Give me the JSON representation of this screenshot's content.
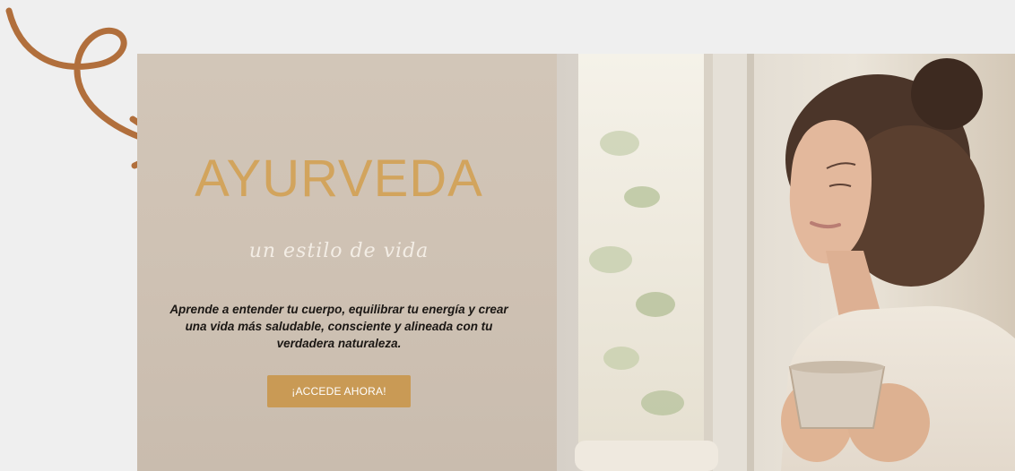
{
  "hero": {
    "title": "AYURVEDA",
    "subtitle": "un estilo de vida",
    "description": "Aprende a entender tu cuerpo, equilibrar tu energía y crear una vida más saludable, consciente y alineada con tu verdadera naturaleza.",
    "cta_label": "¡ACCEDE AHORA!"
  },
  "colors": {
    "background": "#efefef",
    "arrow": "#b16f3c",
    "title": "#d2a45d",
    "button": "#c99a55",
    "panel": "#cfc2b4"
  },
  "icons": {
    "arrow": "curved-arrow-icon",
    "photo": "woman-holding-cup-photo"
  }
}
